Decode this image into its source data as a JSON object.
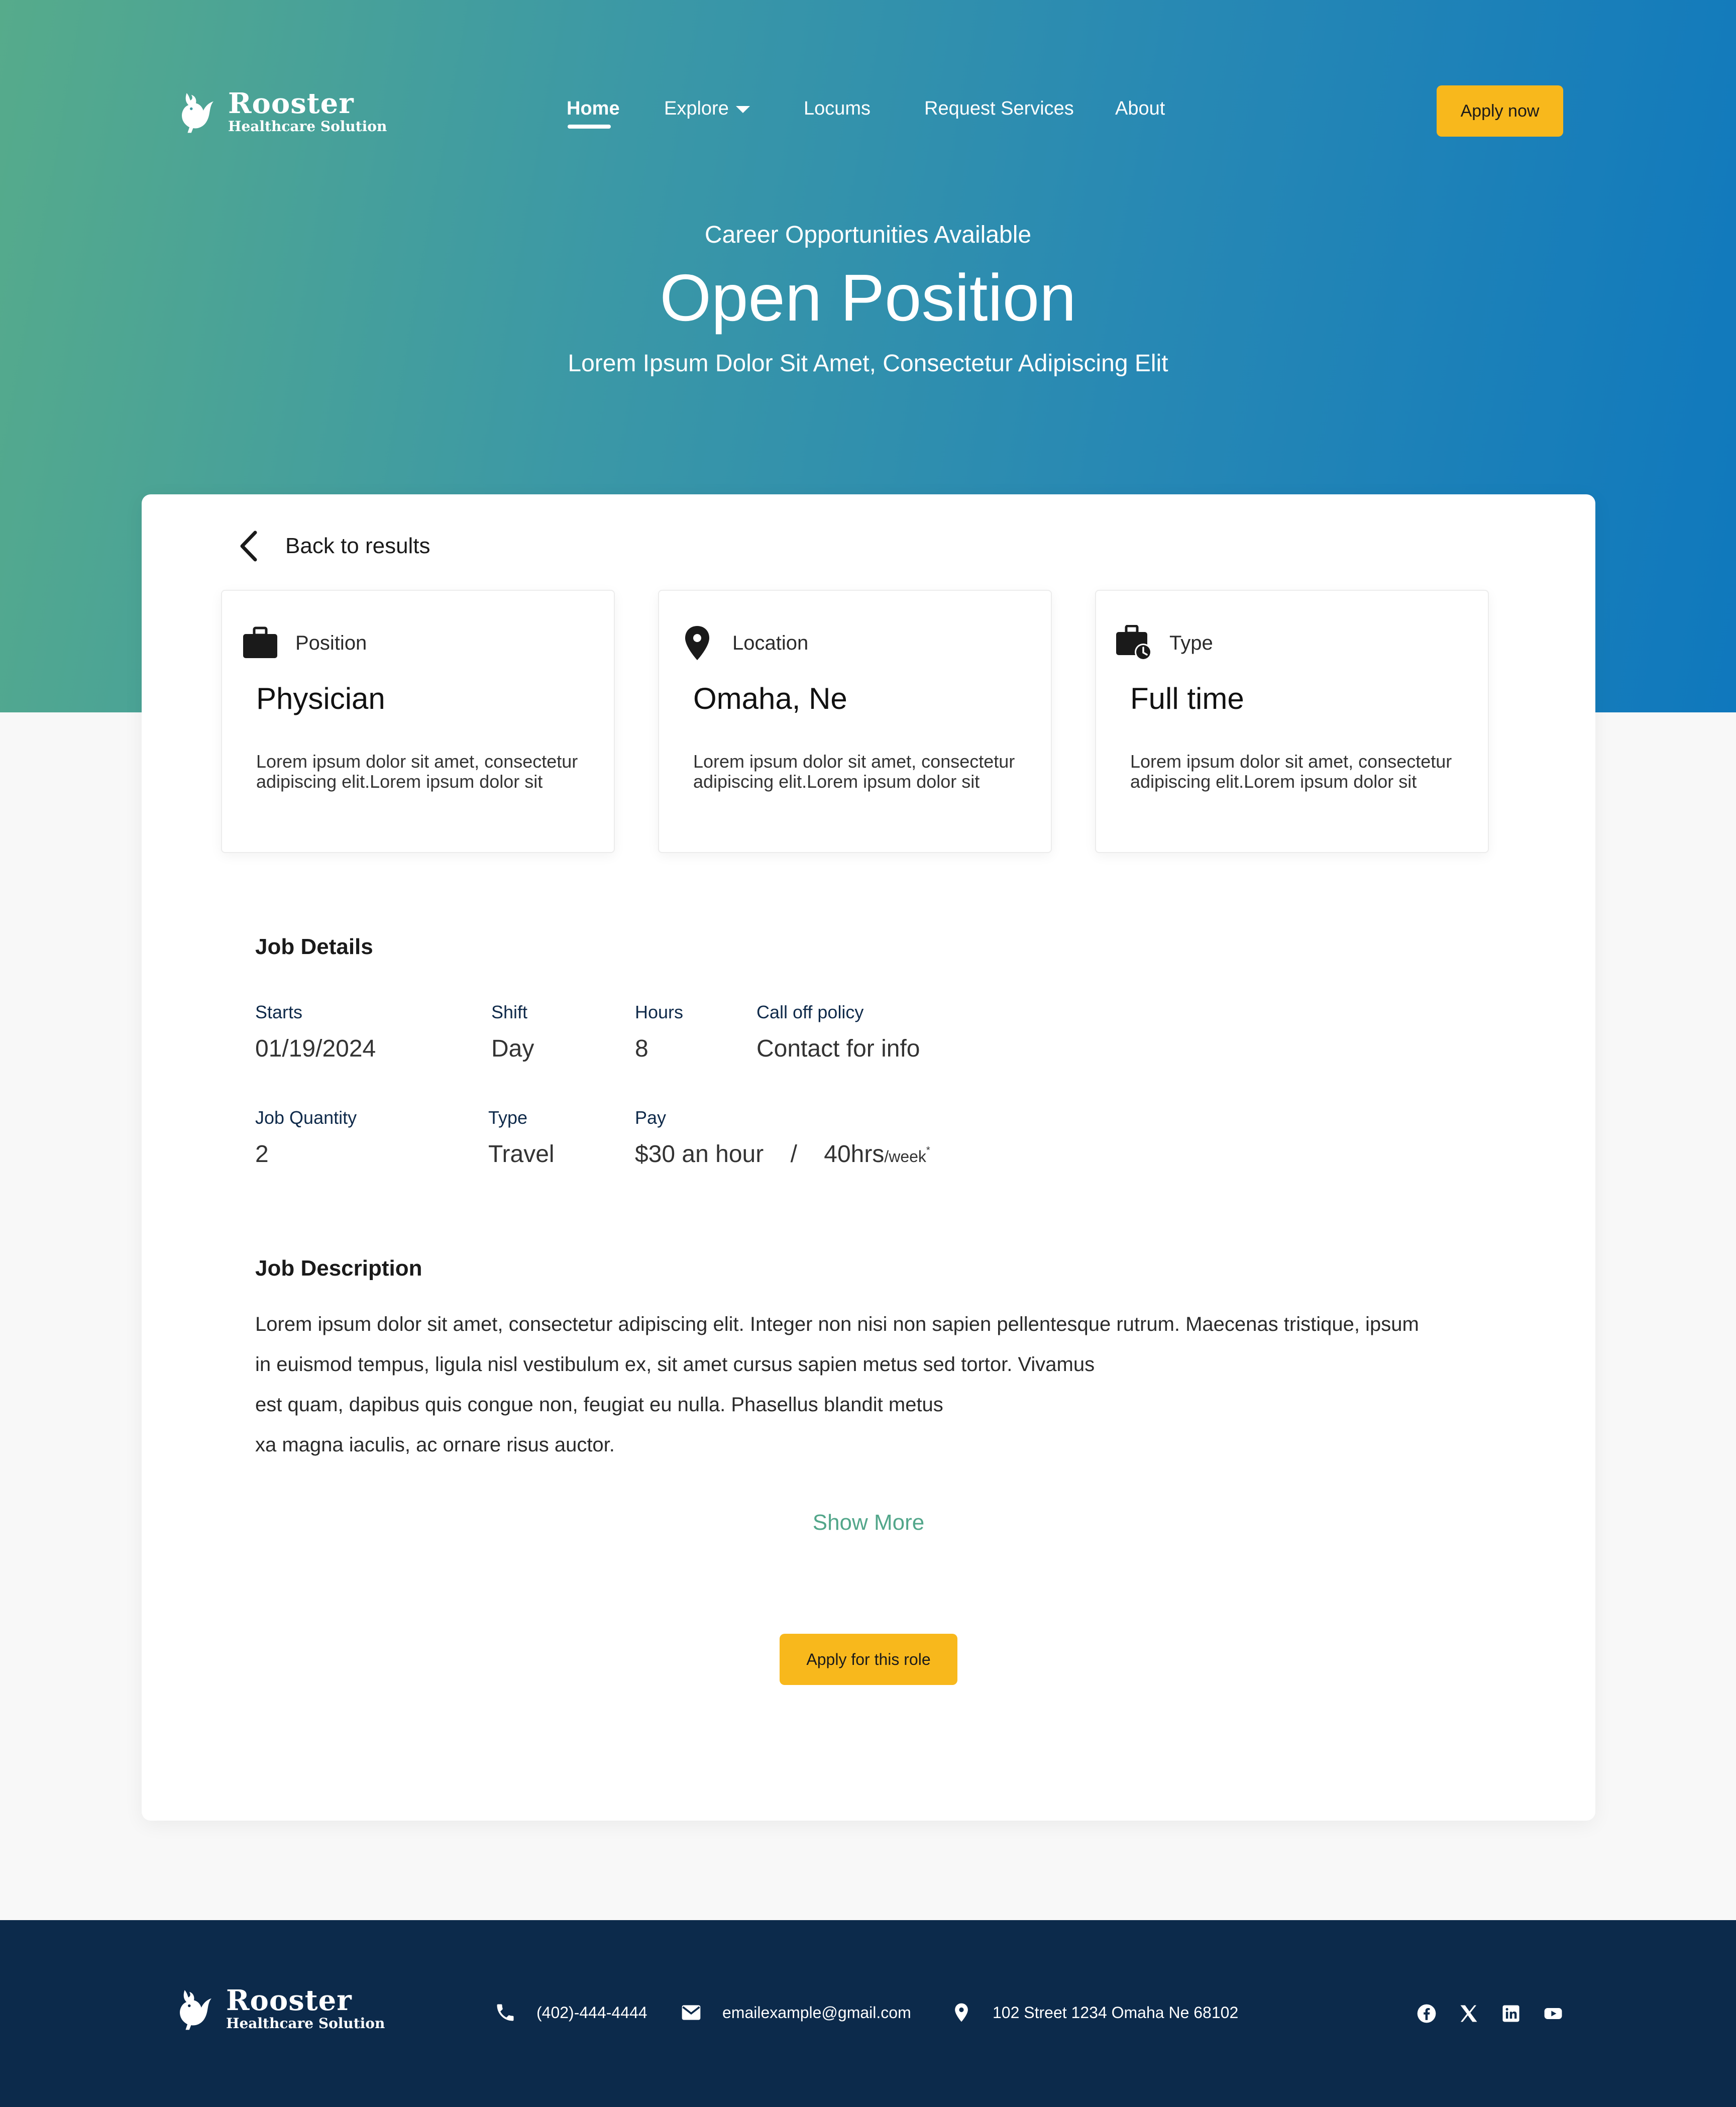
{
  "brand": {
    "name": "Rooster",
    "tagline": "Healthcare Solution"
  },
  "nav": {
    "items": [
      {
        "label": "Home"
      },
      {
        "label": "Explore"
      },
      {
        "label": "Locums"
      },
      {
        "label": "Request Services"
      },
      {
        "label": "About"
      }
    ],
    "cta": "Apply now"
  },
  "hero": {
    "kicker": "Career Opportunities Available",
    "title": "Open Position",
    "subtitle": "Lorem Ipsum Dolor Sit Amet, Consectetur Adipiscing Elit"
  },
  "back_label": "Back to results",
  "info_cards": [
    {
      "icon": "briefcase-icon",
      "label": "Position",
      "value": "Physician",
      "desc": "Lorem ipsum dolor sit amet, consectetur adipiscing elit.Lorem ipsum dolor sit"
    },
    {
      "icon": "location-pin-icon",
      "label": "Location",
      "value": "Omaha, Ne",
      "desc": "Lorem ipsum dolor sit amet, consectetur adipiscing elit.Lorem ipsum dolor sit"
    },
    {
      "icon": "briefcase-clock-icon",
      "label": "Type",
      "value": "Full time",
      "desc": "Lorem ipsum dolor sit amet, consectetur adipiscing elit.Lorem ipsum dolor sit"
    }
  ],
  "job_details": {
    "title": "Job Details",
    "starts": {
      "label": "Starts",
      "value": "01/19/2024"
    },
    "shift": {
      "label": "Shift",
      "value": "Day"
    },
    "hours": {
      "label": "Hours",
      "value": "8"
    },
    "call_off": {
      "label": "Call off policy",
      "value": "Contact for info"
    },
    "quantity": {
      "label": "Job Quantity",
      "value": "2"
    },
    "type": {
      "label": "Type",
      "value": "Travel"
    },
    "pay": {
      "label": "Pay",
      "rate": "$30 an hour",
      "separator": "/",
      "hours": "40hrs",
      "unit": "/week",
      "mark": "*"
    }
  },
  "job_description": {
    "title": "Job Description",
    "lines": [
      "Lorem ipsum dolor sit amet, consectetur adipiscing elit. Integer non nisi non sapien pellentesque rutrum. Maecenas tristique, ipsum",
      "in euismod tempus, ligula nisl vestibulum ex, sit amet cursus sapien metus sed tortor. Vivamus",
      "est quam, dapibus quis congue non, feugiat eu nulla. Phasellus blandit metus",
      "xa magna iaculis, ac ornare risus auctor."
    ],
    "show_more": "Show More"
  },
  "apply_role": "Apply for this role",
  "footer": {
    "phone": "(402)-444-4444",
    "email": "emailexample@gmail.com",
    "address": "102 Street 1234 Omaha Ne 68102",
    "social": [
      "facebook-icon",
      "x-icon",
      "linkedin-icon",
      "youtube-icon"
    ]
  },
  "colors": {
    "accent": "#f8b81c",
    "hero_start": "#56ab8b",
    "hero_end": "#0f78bd",
    "link_green": "#52a68a",
    "footer_bg": "#0c2a4b"
  }
}
